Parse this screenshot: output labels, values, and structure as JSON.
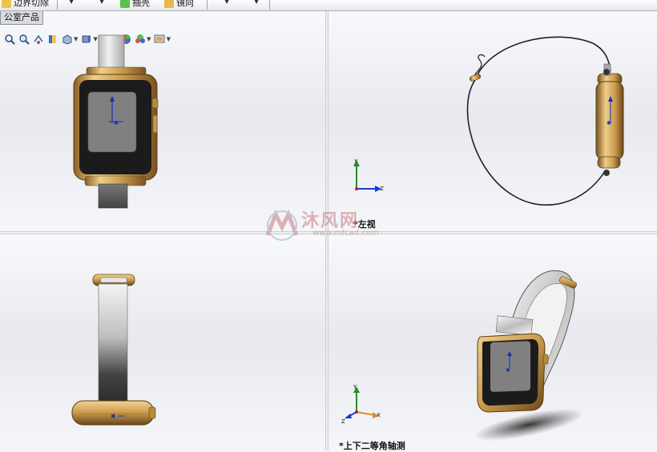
{
  "toolbar": {
    "item1_label": "边界切除",
    "item2_label": "抽壳",
    "item3_label": "镜向"
  },
  "tab": {
    "label": "公室产品"
  },
  "viewports": {
    "top_right": {
      "label": "*左视"
    },
    "bottom_right": {
      "label": "*上下二等角轴测"
    }
  },
  "triad": {
    "x": "X",
    "y": "Y",
    "z": "Z"
  },
  "watermark": {
    "brand": "沐风网",
    "url": "www.mfcad.com"
  },
  "hud_icons": [
    "zoom-to-fit-icon",
    "zoom-area-icon",
    "previous-view-icon",
    "section-view-icon",
    "view-orientation-icon",
    "display-style-icon",
    "hide-show-icon",
    "edit-appearance-icon",
    "apply-scene-icon",
    "view-settings-icon"
  ],
  "colors": {
    "gold": "#c9a05a",
    "screen": "#808080",
    "bezel": "#1b1b1b",
    "band_gray": "#5a5a5a"
  }
}
